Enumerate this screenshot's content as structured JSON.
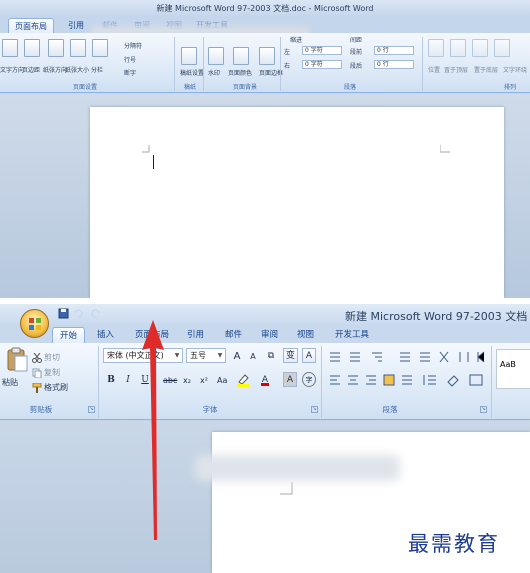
{
  "top": {
    "title": "新建 Microsoft Word 97-2003 文档.doc - Microsoft Word",
    "tabs": [
      "页面布局",
      "引用",
      "邮件",
      "审阅",
      "视图",
      "开发工具"
    ],
    "page_setup": {
      "buttons": [
        "文字方向",
        "页边距",
        "纸张方向",
        "纸张大小",
        "分栏"
      ],
      "small_buttons": [
        "分隔符",
        "行号",
        "断字"
      ],
      "label": "页面设置"
    },
    "draft": {
      "button": "稿纸设置",
      "label": "稿纸"
    },
    "page_bg": {
      "buttons": [
        "水印",
        "页面颜色",
        "页面边框"
      ],
      "label": "页面背景"
    },
    "paragraph": {
      "indent_title": "缩进",
      "spacing_title": "间距",
      "left_label": "左",
      "right_label": "右",
      "before_label": "段前",
      "after_label": "段后",
      "left_value": "0 字符",
      "right_value": "0 字符",
      "before_value": "0 行",
      "after_value": "0 行",
      "label": "段落"
    },
    "arrange": {
      "buttons": [
        "位置",
        "置于顶层",
        "置于底层",
        "文字环绕"
      ],
      "label": "排列"
    }
  },
  "bottom": {
    "title": "新建 Microsoft Word 97-2003 文档",
    "tabs": [
      "开始",
      "插入",
      "页面布局",
      "引用",
      "邮件",
      "审阅",
      "视图",
      "开发工具"
    ],
    "clipboard": {
      "paste": "粘贴",
      "cut": "剪切",
      "copy": "复制",
      "format_painter": "格式刷",
      "label": "剪贴板"
    },
    "font": {
      "font_name": "宋体 (中文正文)",
      "font_size": "五号",
      "label": "字体",
      "bold": "B",
      "italic": "I",
      "underline": "U",
      "strike": "abc",
      "subscript": "x₂",
      "superscript": "x²",
      "change_case": "Aa",
      "grow": "A",
      "shrink": "A",
      "clear": "⧉",
      "phonetic": "变",
      "border": "A",
      "shading": "A",
      "enclose": "字"
    },
    "paragraph": {
      "label": "段落"
    },
    "styles": {
      "preview": "AaB"
    },
    "watermark": "最需教育"
  }
}
